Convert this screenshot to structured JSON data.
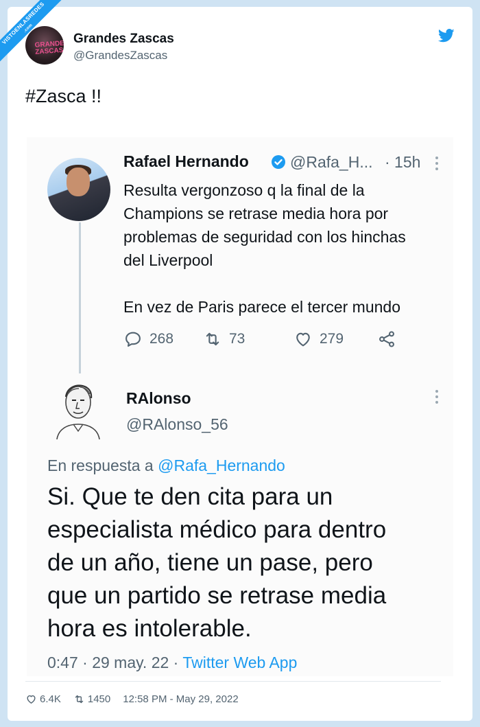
{
  "watermark": {
    "line1": "VISTOENLASREDES",
    "line2": ".com"
  },
  "author": {
    "name": "Grandes Zascas",
    "handle": "@GrandesZascas",
    "avatar_text": "GRANDES ZASCAS"
  },
  "tweet_text": "#Zasca !!",
  "quoted_tweet": {
    "name": "Rafael Hernando",
    "handle": "@Rafa_H...",
    "time": "· 15h",
    "lines": [
      "Resulta vergonzoso q la final de la",
      "Champions se retrase media hora por",
      "problemas de seguridad con los hinchas",
      "del Liverpool",
      "En vez de Paris parece el  tercer mundo"
    ],
    "replies": "268",
    "retweets": "73",
    "likes": "279"
  },
  "reply_tweet": {
    "name": "RAlonso",
    "handle": "@RAlonso_56",
    "reply_prefix": "En respuesta a",
    "reply_to": "@Rafa_Hernando",
    "lines": [
      "Si. Que te den cita para un",
      "especialista médico para dentro",
      "de un año, tiene un pase, pero",
      "que un partido se retrase media",
      "hora es intolerable."
    ],
    "time_date": "0:47 · 29 may. 22 ·",
    "source": "Twitter Web App"
  },
  "footer": {
    "likes": "6.4K",
    "retweets": "1450",
    "timestamp": "12:58 PM - May 29, 2022"
  },
  "icons": [
    "twitter-bird-icon",
    "verified-badge-icon",
    "reply-icon",
    "retweet-icon",
    "like-icon",
    "share-icon",
    "more-icon"
  ],
  "colors": {
    "accent": "#1d9bf0",
    "text": "#0f1419",
    "muted": "#536471",
    "background": "#cfe3f3"
  }
}
